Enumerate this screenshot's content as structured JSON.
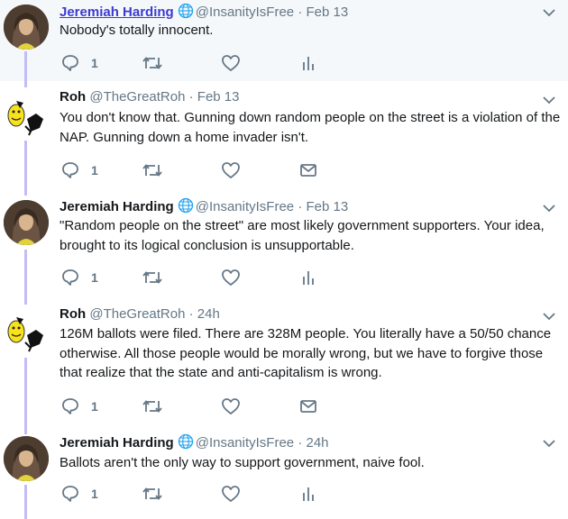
{
  "tweets": [
    {
      "name": "Jeremiah Harding",
      "verified_globe": true,
      "handle": "@InsanityIsFree",
      "time": "Feb 13",
      "text": "Nobody's totally innocent.",
      "replies": "1",
      "extra_icon": "analytics-icon"
    },
    {
      "name": "Roh",
      "verified_globe": false,
      "handle": "@TheGreatRoh",
      "time": "Feb 13",
      "text": "You don't know that. Gunning down random people on the street is a violation of the NAP. Gunning down a home invader isn't.",
      "replies": "1",
      "extra_icon": "mail-icon"
    },
    {
      "name": "Jeremiah Harding",
      "verified_globe": true,
      "handle": "@InsanityIsFree",
      "time": "Feb 13",
      "text": "\"Random people on the street\" are most likely government supporters. Your idea, brought to its logical conclusion is unsupportable.",
      "replies": "1",
      "extra_icon": "analytics-icon"
    },
    {
      "name": "Roh",
      "verified_globe": false,
      "handle": "@TheGreatRoh",
      "time": "24h",
      "text": "126M ballots were filed. There are 328M people. You literally have a 50/50 chance otherwise. All those people would be morally wrong, but we have to forgive those that realize that the state and anti-capitalism is wrong.",
      "replies": "1",
      "extra_icon": "mail-icon"
    },
    {
      "name": "Jeremiah Harding",
      "verified_globe": true,
      "handle": "@InsanityIsFree",
      "time": "24h",
      "text": "Ballots aren't the only way to support government, naive fool.",
      "replies": "1",
      "extra_icon": "analytics-icon"
    }
  ],
  "separator": "·",
  "colors": {
    "thread_line": "#c4bdf5",
    "highlight_bg": "#f5f8fa",
    "link_name": "#3b3bd0",
    "muted": "#657786"
  }
}
